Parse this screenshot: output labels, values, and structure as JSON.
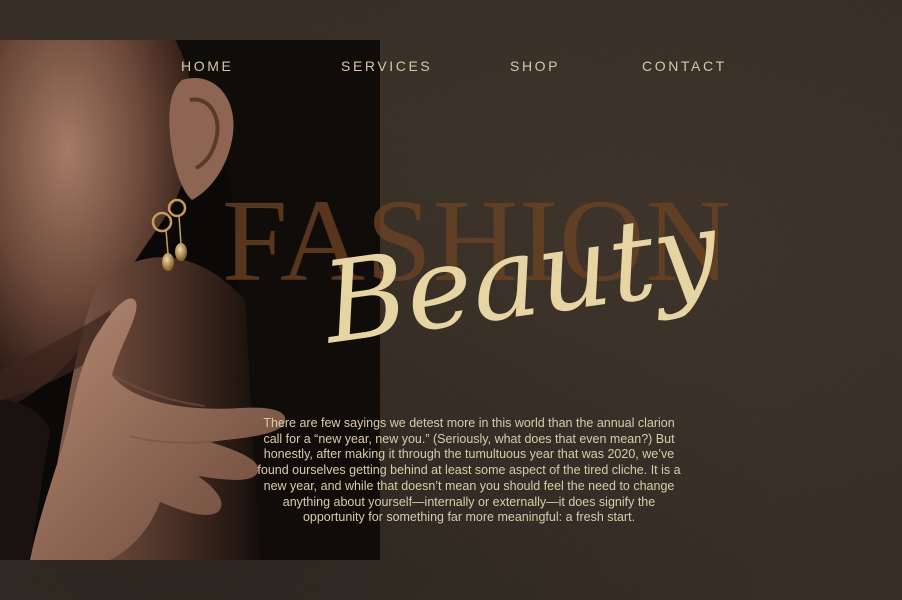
{
  "nav": {
    "items": [
      {
        "label": "HOME"
      },
      {
        "label": "SERVICES"
      },
      {
        "label": "SHOP"
      },
      {
        "label": "CONTACT"
      }
    ]
  },
  "hero": {
    "background_word": "FASHION",
    "script_word": "Beauty",
    "paragraph": "There are few sayings we detest more in this world than the annual clarion call for a “new year, new you.” (Seriously, what does that even mean?) But honestly, after making it through the tumultuous year that was 2020, we’ve found ourselves getting behind at least some aspect of the tired cliche. It is a new year, and while that doesn’t mean you should feel the need to change anything about yourself—internally or externally—it does signify the opportunity for something far more meaningful: a fresh start."
  },
  "colors": {
    "background": "#2e261f",
    "nav_text": "#d7c7a6",
    "fashion_word": "#6b4323",
    "script_gold": "#e6d4a3",
    "paragraph_text": "#d9cba9"
  }
}
